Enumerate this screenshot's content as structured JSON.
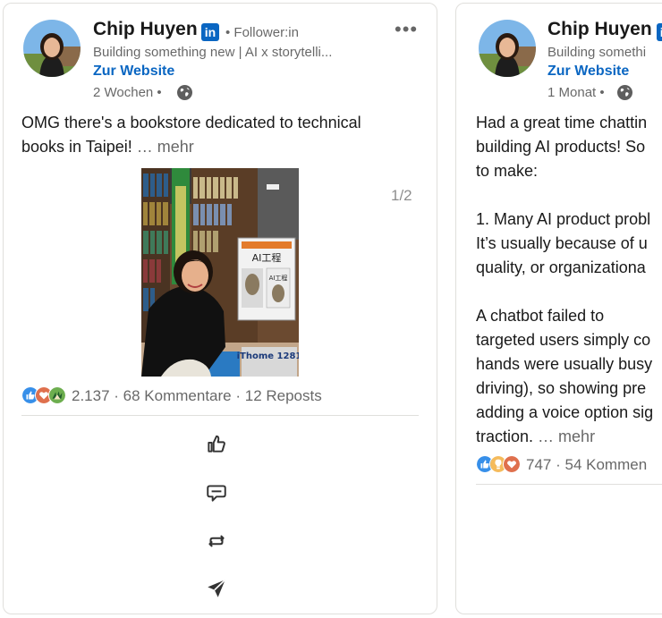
{
  "posts": [
    {
      "author": "Chip Huyen",
      "linkedin_badge": "in",
      "follower_label": "• Follower:in",
      "headline": "Building something new | AI x storytelli...",
      "website_label": "Zur Website",
      "timestamp": "2 Wochen •",
      "text_lines": [
        "OMG there's a bookstore dedicated to technical",
        "books in Taipei!"
      ],
      "more_label": "… mehr",
      "image_pager": "1/2",
      "reaction_count": "2.137",
      "comments": "· 68 Kommentare",
      "reposts": "· 12 Reposts",
      "photo_sign_title": "AI工程",
      "photo_sign_sub": "AI工程",
      "photo_magazine": "iThome 1281"
    },
    {
      "author": "Chip Huyen",
      "linkedin_badge": "in",
      "headline": "Building somethi",
      "website_label": "Zur Website",
      "timestamp": "1 Monat •",
      "text_lines": [
        "Had a great time chattin",
        "building AI products! So",
        "to make:",
        "",
        "1. Many AI product probl",
        "It’s usually because of u",
        "quality, or organizationa",
        "",
        "A chatbot failed to",
        "targeted users simply co",
        "hands were usually busy",
        "driving), so showing pre",
        "adding a voice option sig",
        "traction."
      ],
      "more_label": "… mehr",
      "reaction_count": "747",
      "comments": "· 54 Kommen"
    }
  ],
  "colors": {
    "accent": "#0a66c2",
    "like": "#378fe9",
    "love": "#df704d",
    "support": "#6dae4f",
    "insight": "#f5bb5c"
  },
  "icons": {
    "like_action": "thumbs-up-icon",
    "comment_action": "comment-icon",
    "repost_action": "repost-icon",
    "send_action": "send-icon",
    "overflow": "more-icon",
    "visibility": "globe-icon"
  }
}
